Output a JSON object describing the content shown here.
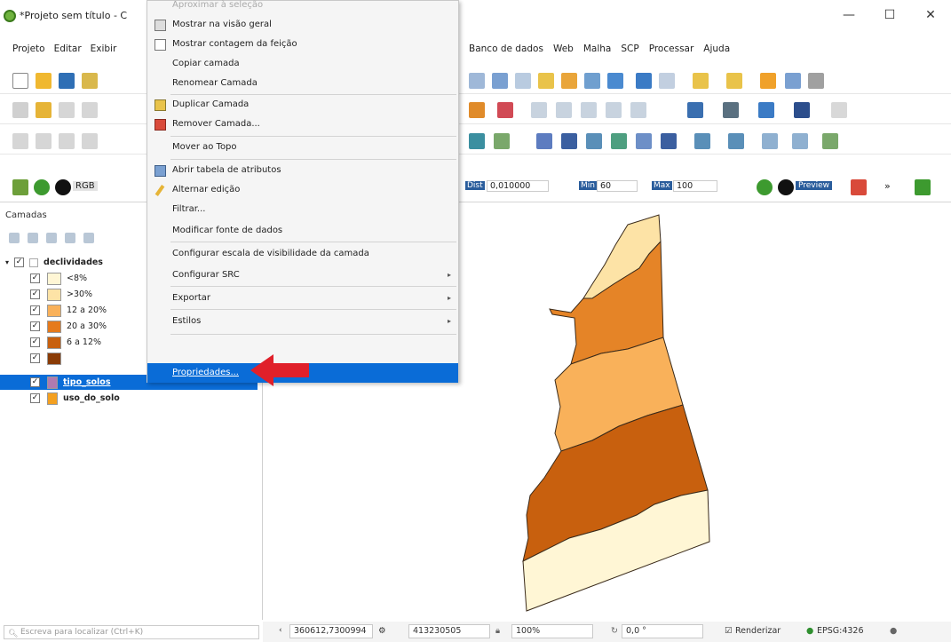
{
  "window": {
    "title": "*Projeto sem título - C",
    "controls": [
      "—",
      "☐",
      "✕"
    ]
  },
  "menubar": {
    "left_items": [
      "Projeto",
      "Editar",
      "Exibir"
    ],
    "right_items": [
      "Banco de dados",
      "Web",
      "Malha",
      "SCP",
      "Processar",
      "Ajuda"
    ]
  },
  "toolbar": {
    "raster_label": "RGB",
    "dist_label": "Dist",
    "dist_value": "0,010000",
    "min_label": "Min",
    "min_value": "60",
    "max_label": "Max",
    "max_value": "100",
    "preview_label": "Preview"
  },
  "layers_panel": {
    "title": "Camadas",
    "layers": [
      {
        "name": "declividades",
        "checked": true,
        "legend": [
          {
            "label": "<8%",
            "color": "#fff6d5",
            "checked": true
          },
          {
            "label": ">30%",
            "color": "#fde3a6",
            "checked": true
          },
          {
            "label": "12 a 20%",
            "color": "#f9b15a",
            "checked": true
          },
          {
            "label": "20 a 30%",
            "color": "#e57a1c",
            "checked": true
          },
          {
            "label": "6 a 12%",
            "color": "#c8600e",
            "checked": true
          },
          {
            "label": "",
            "color": "#8a3b05",
            "checked": true
          }
        ]
      },
      {
        "name": "tipo_solos",
        "checked": true,
        "color": "#b07ab0",
        "selected": true
      },
      {
        "name": "uso_do_solo",
        "checked": true,
        "color": "#f4a020"
      }
    ],
    "locator_placeholder": "Escreva para localizar (Ctrl+K)"
  },
  "context_menu": {
    "items": [
      {
        "label": "Aproximar à seleção",
        "faded": true
      },
      {
        "label": "Mostrar na visão geral",
        "icon": "overview-icon"
      },
      {
        "label": "Mostrar contagem da feição",
        "icon": "checkbox-icon"
      },
      {
        "label": "Copiar camada"
      },
      {
        "label": "Renomear Camada"
      },
      {
        "label": "Duplicar Camada",
        "icon": "duplicate-icon"
      },
      {
        "label": "Remover Camada...",
        "icon": "remove-layer-icon"
      },
      {
        "label": "Mover ao Topo"
      },
      {
        "label": "Abrir tabela de atributos",
        "icon": "table-icon"
      },
      {
        "label": "Alternar edição",
        "icon": "pencil-icon"
      },
      {
        "label": "Filtrar..."
      },
      {
        "label": "Modificar fonte de dados"
      },
      {
        "label": "Configurar escala de visibilidade da camada"
      },
      {
        "label": "Configurar SRC",
        "submenu": true
      },
      {
        "label": "Exportar",
        "submenu": true
      },
      {
        "label": "Estilos",
        "submenu": true
      },
      {
        "label": "Propriedades...",
        "highlighted": true
      }
    ]
  },
  "statusbar": {
    "coordinate_value": "360612,7300994",
    "scale_value": "413230505",
    "magnifier_value": "100%",
    "rotation_value": "0,0 °",
    "render_label": "Renderizar",
    "crs_label": "EPSG:4326"
  },
  "map": {
    "polygon_colors": [
      "#fde3a6",
      "#e58427",
      "#f9b15a",
      "#c8600e",
      "#fff6d5"
    ]
  }
}
